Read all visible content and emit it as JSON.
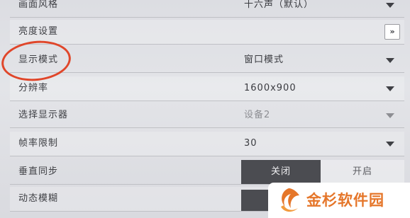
{
  "settings": {
    "rows": [
      {
        "label": "画面风格",
        "value": "十六声（默认）"
      },
      {
        "label": "亮度设置",
        "button_label": "»"
      },
      {
        "label": "显示模式",
        "value": "窗口模式"
      },
      {
        "label": "分辨率",
        "value": "1600x900"
      },
      {
        "label": "选择显示器",
        "value": "设备2"
      },
      {
        "label": "帧率限制",
        "value": "30"
      },
      {
        "label": "垂直同步",
        "off_label": "关闭",
        "on_label": "开启"
      },
      {
        "label": "动态模糊"
      }
    ]
  },
  "annotation": {
    "color": "#e0462a"
  },
  "watermark": {
    "text": "金杉软件园"
  },
  "colors": {
    "toggle_active": "#4b4c51",
    "accent": "#e5762a"
  }
}
